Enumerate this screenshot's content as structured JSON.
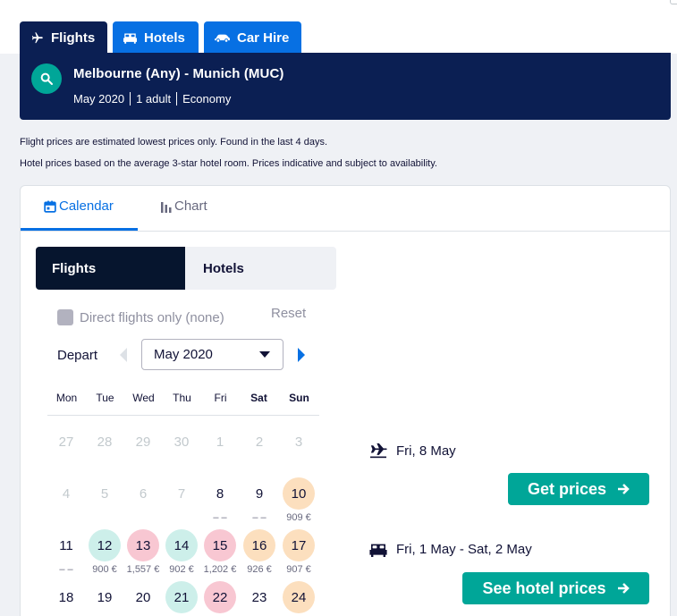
{
  "nav": {
    "tabs": [
      {
        "label": "Flights",
        "icon": "plane-icon"
      },
      {
        "label": "Hotels",
        "icon": "bed-icon"
      },
      {
        "label": "Car Hire",
        "icon": "car-icon"
      }
    ]
  },
  "search": {
    "route": "Melbourne (Any) - Munich (MUC)",
    "month": "May 2020",
    "travellers": "1 adult",
    "cabin": "Economy"
  },
  "notes": {
    "flights": "Flight prices are estimated lowest prices only. Found in the last 4 days.",
    "hotels": "Hotel prices based on the average 3-star hotel room. Prices indicative and subject to availability."
  },
  "card_tabs": {
    "calendar": "Calendar",
    "chart": "Chart"
  },
  "segment": {
    "flights": "Flights",
    "hotels": "Hotels"
  },
  "filters": {
    "direct_label": "Direct flights only (none)",
    "reset": "Reset"
  },
  "depart": {
    "label": "Depart",
    "month": "May 2020"
  },
  "weekdays": [
    "Mon",
    "Tue",
    "Wed",
    "Thu",
    "Fri",
    "Sat",
    "Sun"
  ],
  "calendar": {
    "rows": [
      [
        {
          "day": "27",
          "state": "off",
          "price": ""
        },
        {
          "day": "28",
          "state": "off",
          "price": ""
        },
        {
          "day": "29",
          "state": "off",
          "price": ""
        },
        {
          "day": "30",
          "state": "off",
          "price": ""
        },
        {
          "day": "1",
          "state": "off",
          "price": ""
        },
        {
          "day": "2",
          "state": "off",
          "price": ""
        },
        {
          "day": "3",
          "state": "off",
          "price": ""
        }
      ],
      [
        {
          "day": "4",
          "state": "off",
          "price": ""
        },
        {
          "day": "5",
          "state": "off",
          "price": ""
        },
        {
          "day": "6",
          "state": "off",
          "price": ""
        },
        {
          "day": "7",
          "state": "off",
          "price": ""
        },
        {
          "day": "8",
          "state": "plain",
          "price": "– –"
        },
        {
          "day": "9",
          "state": "plain",
          "price": "– –"
        },
        {
          "day": "10",
          "state": "orange",
          "price": "909 €"
        }
      ],
      [
        {
          "day": "11",
          "state": "plain",
          "price": "– –"
        },
        {
          "day": "12",
          "state": "green",
          "price": "900 €"
        },
        {
          "day": "13",
          "state": "pink",
          "price": "1,557 €"
        },
        {
          "day": "14",
          "state": "green",
          "price": "902 €"
        },
        {
          "day": "15",
          "state": "pink",
          "price": "1,202 €"
        },
        {
          "day": "16",
          "state": "orange",
          "price": "926 €"
        },
        {
          "day": "17",
          "state": "orange",
          "price": "907 €"
        }
      ],
      [
        {
          "day": "18",
          "state": "plain",
          "price": ""
        },
        {
          "day": "19",
          "state": "plain",
          "price": ""
        },
        {
          "day": "20",
          "state": "plain",
          "price": ""
        },
        {
          "day": "21",
          "state": "green",
          "price": ""
        },
        {
          "day": "22",
          "state": "pink",
          "price": ""
        },
        {
          "day": "23",
          "state": "plain",
          "price": ""
        },
        {
          "day": "24",
          "state": "orange",
          "price": ""
        }
      ]
    ]
  },
  "summary": {
    "flight_date": "Fri, 8 May",
    "get_prices": "Get prices",
    "hotel_dates": "Fri, 1 May - Sat, 2 May",
    "see_hotel_prices": "See hotel prices"
  },
  "colors": {
    "navy": "#0b1f53",
    "blue": "#0770e3",
    "teal": "#00a698",
    "cheap": "#cdefea",
    "expensive": "#f8c7d2",
    "mid": "#fcdfbe"
  }
}
